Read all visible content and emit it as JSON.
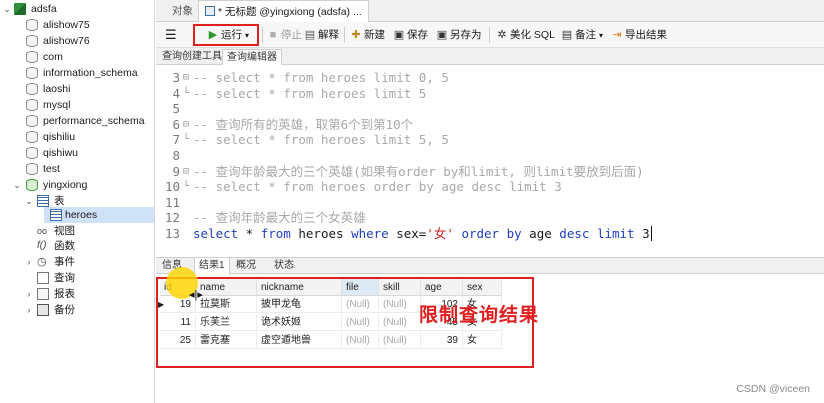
{
  "sidebar": {
    "connection": "adsfa",
    "databases": [
      "alishow75",
      "alishow76",
      "com",
      "information_schema",
      "laoshi",
      "mysql",
      "performance_schema",
      "qishiliu",
      "qishiwu",
      "test"
    ],
    "active_db": "yingxiong",
    "tables_label": "表",
    "active_table": "heroes",
    "other_nodes": [
      "视图",
      "函数",
      "事件",
      "查询",
      "报表",
      "备份"
    ]
  },
  "tabs": {
    "objects": "对象",
    "query_tab": "* 无标题 @yingxiong (adsfa) ..."
  },
  "toolbar": {
    "menu_icon": "hamburger-icon",
    "run": "运行",
    "stop": "停止",
    "explain": "解释",
    "new": "新建",
    "save": "保存",
    "save_as": "另存为",
    "beautify": "美化 SQL",
    "comment": "备注",
    "export": "导出结果"
  },
  "subtabs": {
    "builder": "查询创建工具",
    "editor": "查询编辑器"
  },
  "editor": {
    "lines": [
      {
        "n": "3",
        "fold": "⊟",
        "text": "-- select * from heroes limit 0, 5",
        "kind": "comment"
      },
      {
        "n": "4",
        "fold": "└",
        "text": "-- select * from heroes limit 5",
        "kind": "comment"
      },
      {
        "n": "5",
        "fold": "",
        "text": "",
        "kind": "blank"
      },
      {
        "n": "6",
        "fold": "⊟",
        "text": "-- 查询所有的英雄，取第6个到第10个",
        "kind": "comment"
      },
      {
        "n": "7",
        "fold": "└",
        "text": "-- select * from heroes limit 5, 5",
        "kind": "comment"
      },
      {
        "n": "8",
        "fold": "",
        "text": "",
        "kind": "blank"
      },
      {
        "n": "9",
        "fold": "⊟",
        "text": "-- 查询年龄最大的三个英雄(如果有order by和limit, 则limit要放到后面)",
        "kind": "comment"
      },
      {
        "n": "10",
        "fold": "└",
        "text": "-- select * from heroes order by age desc limit 3",
        "kind": "comment"
      },
      {
        "n": "11",
        "fold": "",
        "text": "",
        "kind": "blank"
      },
      {
        "n": "12",
        "fold": "",
        "text": "-- 查询年龄最大的三个女英雄",
        "kind": "comment"
      },
      {
        "n": "13",
        "fold": "",
        "text": "",
        "kind": "sql"
      }
    ],
    "sql": {
      "kw1": "select",
      "star": " * ",
      "kw2": "from",
      "table": " heroes ",
      "kw3": "where",
      "cond": " sex=",
      "value": "'女'",
      "space": " ",
      "kw4": "order by",
      "col": " age ",
      "kw5": "desc",
      "space2": " ",
      "kw6": "limit",
      "limit": " 3"
    }
  },
  "result_tabs": [
    "信息",
    "结果1",
    "概况",
    "状态"
  ],
  "result": {
    "columns": [
      "id",
      "name",
      "nickname",
      "file",
      "skill",
      "age",
      "sex"
    ],
    "rows": [
      [
        "19",
        "拉莫斯",
        "披甲龙龟",
        "(Null)",
        "(Null)",
        "102",
        "女"
      ],
      [
        "11",
        "乐芙兰",
        "诡术妖姬",
        "(Null)",
        "(Null)",
        "45",
        "女"
      ],
      [
        "25",
        "雷克塞",
        "虚空遁地兽",
        "(Null)",
        "(Null)",
        "39",
        "女"
      ]
    ]
  },
  "annotation": "限制查询结果",
  "watermark": "CSDN @viceen",
  "colors": {
    "highlight_box": "#e02020",
    "keyword": "#1f3fbf",
    "comment": "#a9a9a9",
    "string": "#c42020",
    "cursor_highlight": "#ffd600"
  }
}
